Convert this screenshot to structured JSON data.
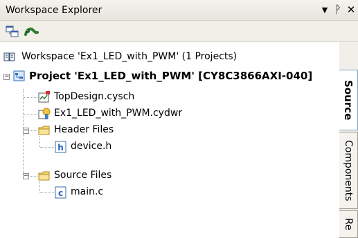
{
  "window": {
    "title": "Workspace Explorer"
  },
  "tree": {
    "workspace": "Workspace 'Ex1_LED_with_PWM' (1 Projects)",
    "project": "Project 'Ex1_LED_with_PWM' [CY8C3866AXI-040]",
    "items": {
      "topdesign": "TopDesign.cysch",
      "cydwr": "Ex1_LED_with_PWM.cydwr",
      "header_folder": "Header Files",
      "device_h": "device.h",
      "source_folder": "Source Files",
      "main_c": "main.c"
    }
  },
  "tabs": {
    "source": "Source",
    "components": "Components",
    "re": "Re"
  },
  "colors": {
    "folder": "#f5d776",
    "project_icon": "#2f6fb6",
    "tab_border": "#7f9db9"
  }
}
